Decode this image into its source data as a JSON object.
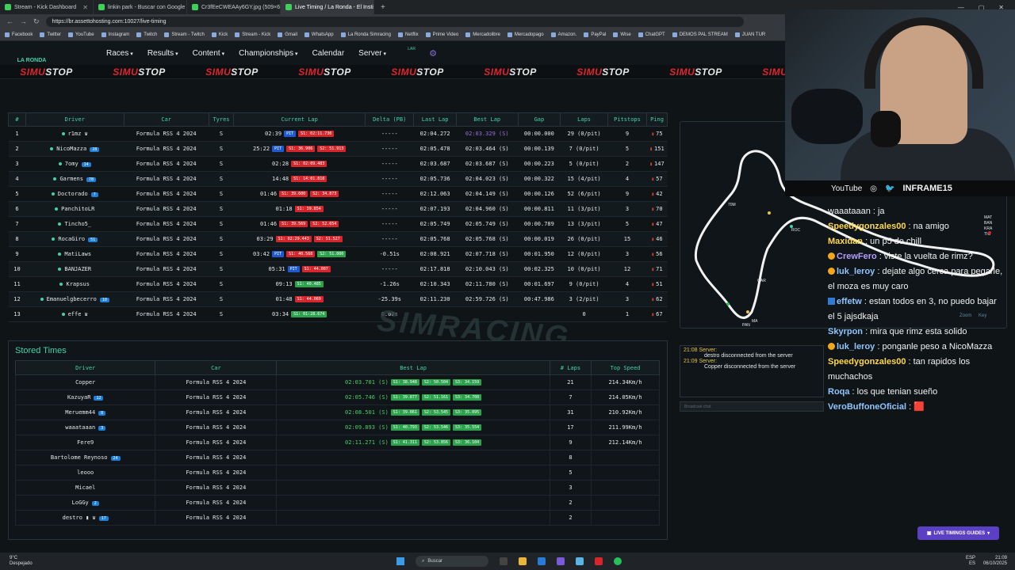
{
  "browser": {
    "tabs": [
      {
        "label": "Stream - Kick Dashboard",
        "active": false
      },
      {
        "label": "linkin park - Buscar con Google",
        "active": false
      },
      {
        "label": "Cr3fEeCWEAAy6GY.jpg (509×600)",
        "active": false
      },
      {
        "label": "Live Timing / La Ronda - El Instit",
        "active": true
      }
    ],
    "url": "https://br.assettohosting.com:10027/live-timing",
    "bookmarks": [
      "Facebook",
      "Twitter",
      "YouTube",
      "Instagram",
      "Twitch",
      "Stream - Twitch",
      "Kick",
      "Stream - Kick",
      "Gmail",
      "WhatsApp",
      "La Ronda Simracing",
      "Netflix",
      "Prime Video",
      "Mercadolibre",
      "Mercadopago",
      "Amazon.",
      "PayPal",
      "Wise",
      "ChatGPT",
      "DEMOS PAL STREAM",
      "JUAN TUR"
    ]
  },
  "site": {
    "logo_text": "LA RONDA",
    "nav": [
      {
        "label": "Races",
        "caret": true
      },
      {
        "label": "Results",
        "caret": true
      },
      {
        "label": "Content",
        "caret": true
      },
      {
        "label": "Championships",
        "caret": true
      },
      {
        "label": "Calendar",
        "caret": false
      },
      {
        "label": "Server",
        "caret": true
      }
    ],
    "small_logo": "LAR",
    "sponsor": "SIMUSTOP",
    "accent": "#3fd3a8"
  },
  "live": {
    "headers": [
      "#",
      "Driver",
      "Car",
      "Tyres",
      "Current Lap",
      "Delta (PB)",
      "Last Lap",
      "Best Lap",
      "Gap",
      "Laps",
      "Pitstops",
      "Ping"
    ],
    "rows": [
      {
        "pos": "1",
        "driver": "r1mz ♛",
        "badge": "",
        "car": "Formula RSS 4 2024",
        "tyre": "S",
        "cur": "02:39",
        "chips": [
          [
            "PIT",
            "pit"
          ],
          [
            "S1: 02:11.730",
            "red"
          ]
        ],
        "delta": "-----",
        "dcls": "delta-red",
        "last": "02:04.272",
        "best": "02:03.329 (S)",
        "bcls": "purple",
        "gap": "00:00.000",
        "laps": "29 (0/pit)",
        "pits": "9",
        "ping": "75"
      },
      {
        "pos": "2",
        "driver": "NicoMazza",
        "badge": "28",
        "car": "Formula RSS 4 2024",
        "tyre": "S",
        "cur": "25:22",
        "chips": [
          [
            "PIT",
            "pit"
          ],
          [
            "S1: 36.906",
            "red"
          ],
          [
            "S2: 51.913",
            "red"
          ]
        ],
        "delta": "-----",
        "dcls": "delta-red",
        "last": "02:05.478",
        "best": "02:03.464 (S)",
        "bcls": "",
        "gap": "00:00.139",
        "laps": "7 (0/pit)",
        "pits": "5",
        "ping": "151"
      },
      {
        "pos": "3",
        "driver": "7omy",
        "badge": "14",
        "car": "Formula RSS 4 2024",
        "tyre": "S",
        "cur": "02:28",
        "chips": [
          [
            "S1: 02:09.483",
            "red"
          ]
        ],
        "delta": "-----",
        "dcls": "delta-red",
        "last": "02:03.687",
        "best": "02:03.687 (S)",
        "bcls": "",
        "gap": "00:00.223",
        "laps": "5 (0/pit)",
        "pits": "2",
        "ping": "147"
      },
      {
        "pos": "4",
        "driver": "Garmens",
        "badge": "78",
        "car": "Formula RSS 4 2024",
        "tyre": "S",
        "cur": "14:48",
        "chips": [
          [
            "S1: 14:01.818",
            "red"
          ]
        ],
        "delta": "-----",
        "dcls": "delta-red",
        "last": "02:05.736",
        "best": "02:04.023 (S)",
        "bcls": "",
        "gap": "00:00.322",
        "laps": "15 (4/pit)",
        "pits": "4",
        "ping": "57"
      },
      {
        "pos": "5",
        "driver": "Doctorado",
        "badge": "7",
        "car": "Formula RSS 4 2024",
        "tyre": "S",
        "cur": "01:46",
        "chips": [
          [
            "S1: 39.600",
            "red"
          ],
          [
            "S2: 34.873",
            "red"
          ]
        ],
        "delta": "-----",
        "dcls": "delta-red",
        "last": "02:12.063",
        "best": "02:04.149 (S)",
        "bcls": "",
        "gap": "00:00.126",
        "laps": "52 (6/pit)",
        "pits": "9",
        "ping": "42"
      },
      {
        "pos": "6",
        "driver": "PanchitoLR",
        "badge": "",
        "car": "Formula RSS 4 2024",
        "tyre": "S",
        "cur": "01:18",
        "chips": [
          [
            "S1: 39.854",
            "red"
          ]
        ],
        "delta": "-----",
        "dcls": "delta-red",
        "last": "02:07.193",
        "best": "02:04.960 (S)",
        "bcls": "",
        "gap": "00:00.811",
        "laps": "11 (3/pit)",
        "pits": "3",
        "ping": "70"
      },
      {
        "pos": "7",
        "driver": "Tincho5_",
        "badge": "",
        "car": "Formula RSS 4 2024",
        "tyre": "S",
        "cur": "01:46",
        "chips": [
          [
            "S1: 39.569",
            "red"
          ],
          [
            "S2: 52.654",
            "red"
          ]
        ],
        "delta": "-----",
        "dcls": "delta-red",
        "last": "02:05.749",
        "best": "02:05.749 (S)",
        "bcls": "",
        "gap": "00:00.789",
        "laps": "13 (3/pit)",
        "pits": "5",
        "ping": "47"
      },
      {
        "pos": "8",
        "driver": "RocaGiro",
        "badge": "51",
        "car": "Formula RSS 4 2024",
        "tyre": "S",
        "cur": "03:29",
        "chips": [
          [
            "S1: 02:29.443",
            "red"
          ],
          [
            "S2: 51.527",
            "red"
          ]
        ],
        "delta": "-----",
        "dcls": "delta-red",
        "last": "02:05.768",
        "best": "02:05.768 (S)",
        "bcls": "",
        "gap": "00:00.019",
        "laps": "26 (0/pit)",
        "pits": "15",
        "ping": "46"
      },
      {
        "pos": "9",
        "driver": "MatiLaws",
        "badge": "",
        "car": "Formula RSS 4 2024",
        "tyre": "S",
        "cur": "03:42",
        "chips": [
          [
            "PIT",
            "pit"
          ],
          [
            "S1: 40.568",
            "red"
          ],
          [
            "S2: 51.000",
            "green"
          ]
        ],
        "delta": "-0.51s",
        "dcls": "delta-green",
        "last": "02:08.921",
        "best": "02:07.718 (S)",
        "bcls": "",
        "gap": "00:01.950",
        "laps": "12 (0/pit)",
        "pits": "3",
        "ping": "56"
      },
      {
        "pos": "10",
        "driver": "BANJAZER",
        "badge": "",
        "car": "Formula RSS 4 2024",
        "tyre": "S",
        "cur": "05:31",
        "chips": [
          [
            "PIT",
            "pit"
          ],
          [
            "S1: 44.007",
            "red"
          ]
        ],
        "delta": "-----",
        "dcls": "delta-red",
        "last": "02:17.818",
        "best": "02:10.043 (S)",
        "bcls": "",
        "gap": "00:02.325",
        "laps": "10 (0/pit)",
        "pits": "12",
        "ping": "71"
      },
      {
        "pos": "11",
        "driver": "Krapsus",
        "badge": "",
        "car": "Formula RSS 4 2024",
        "tyre": "S",
        "cur": "09:13",
        "chips": [
          [
            "S1: 40.485",
            "green"
          ]
        ],
        "delta": "-1.26s",
        "dcls": "delta-green",
        "last": "02:10.343",
        "best": "02:11.780 (S)",
        "bcls": "",
        "gap": "00:01.697",
        "laps": "9 (0/pit)",
        "pits": "4",
        "ping": "51"
      },
      {
        "pos": "12",
        "driver": "Emanuelgbecerro",
        "badge": "10",
        "car": "Formula RSS 4 2024",
        "tyre": "S",
        "cur": "01:48",
        "chips": [
          [
            "S1: 44.069",
            "red"
          ]
        ],
        "delta": "-25.39s",
        "dcls": "delta-green",
        "last": "02:11.230",
        "best": "02:59.726 (S)",
        "bcls": "",
        "gap": "00:47.986",
        "laps": "3 (2/pit)",
        "pits": "3",
        "ping": "62"
      },
      {
        "pos": "13",
        "driver": "effe ♛",
        "badge": "",
        "car": "Formula RSS 4 2024",
        "tyre": "S",
        "cur": "03:34",
        "chips": [
          [
            "S1: 01:28.674",
            "green"
          ]
        ],
        "delta": "0.00s",
        "dcls": "delta-yellow",
        "last": "",
        "best": "",
        "bcls": "",
        "gap": "",
        "laps": "0",
        "pits": "1",
        "ping": "67"
      }
    ]
  },
  "stored": {
    "title": "Stored Times",
    "headers": [
      "Driver",
      "Car",
      "Best Lap",
      "# Laps",
      "Top Speed"
    ],
    "rows": [
      {
        "driver": "Copper",
        "badge": "",
        "car": "Formula RSS 4 2024",
        "best": "02:03.701 (S)",
        "splits": [
          "S1: 38.948",
          "S2: 50.504",
          "S3: 34.159"
        ],
        "laps": "21",
        "speed": "214.34Km/h"
      },
      {
        "driver": "KazuyaR",
        "badge": "12",
        "car": "Formula RSS 4 2024",
        "best": "02:05.746 (S)",
        "splits": [
          "S1: 39.877",
          "S2: 51.161",
          "S3: 34.708"
        ],
        "laps": "7",
        "speed": "214.05Km/h"
      },
      {
        "driver": "Meruemm44",
        "badge": "8",
        "car": "Formula RSS 4 2024",
        "best": "02:08.501 (S)",
        "splits": [
          "S1: 39.861",
          "S2: 53.545",
          "S3: 35.095"
        ],
        "laps": "31",
        "speed": "210.92Km/h"
      },
      {
        "driver": "waaataaan",
        "badge": "3",
        "car": "Formula RSS 4 2024",
        "best": "02:09.893 (S)",
        "splits": [
          "S1: 40.793",
          "S2: 53.546",
          "S3: 35.554"
        ],
        "laps": "17",
        "speed": "211.99Km/h"
      },
      {
        "driver": "Fere9",
        "badge": "",
        "car": "Formula RSS 4 2024",
        "best": "02:11.271 (S)",
        "splits": [
          "S1: 41.311",
          "S2: 53.856",
          "S3: 36.104"
        ],
        "laps": "9",
        "speed": "212.14Km/h"
      },
      {
        "driver": "Bartolome Reynoso",
        "badge": "24",
        "car": "Formula RSS 4 2024",
        "best": "",
        "splits": [],
        "laps": "8",
        "speed": ""
      },
      {
        "driver": "leooo",
        "badge": "",
        "car": "Formula RSS 4 2024",
        "best": "",
        "splits": [],
        "laps": "5",
        "speed": ""
      },
      {
        "driver": "Micael",
        "badge": "",
        "car": "Formula RSS 4 2024",
        "best": "",
        "splits": [],
        "laps": "3",
        "speed": ""
      },
      {
        "driver": "LoGGy",
        "badge": "2",
        "car": "Formula RSS 4 2024",
        "best": "",
        "splits": [],
        "laps": "2",
        "speed": ""
      },
      {
        "driver": "destro ▮ ♛",
        "badge": "17",
        "car": "Formula RSS 4 2024",
        "best": "",
        "splits": [],
        "laps": "2",
        "speed": ""
      }
    ]
  },
  "map": {
    "labels": [
      "70M",
      "ROC",
      "GAR",
      "MA",
      "PAN",
      "MAT",
      "BAN",
      "KRA",
      "TIC"
    ],
    "zoom": "Zoom",
    "key": "Key"
  },
  "server_log": [
    {
      "time": "21:08 Server:",
      "msg": "destro disconnected from the server"
    },
    {
      "time": "21:09 Server:",
      "msg": "Copper disconnected from the server"
    }
  ],
  "broadcast_placeholder": "Broadcast chat",
  "stream": {
    "socials": [
      "YouTube",
      "◎",
      "🐦"
    ],
    "handle": "INFRAME15",
    "chat": [
      {
        "user": "",
        "cls": "",
        "text": "waaataaan : ja",
        "badge": ""
      },
      {
        "user": "Speedygonzales00",
        "cls": "u1",
        "text": " : na amigo",
        "badge": ""
      },
      {
        "user": "Maxidan",
        "cls": "u1",
        "text": " : un p5 de chill",
        "badge": ""
      },
      {
        "user": "CrewFero",
        "cls": "u3",
        "text": " : viste la vuelta de rimz?",
        "badge": "gold"
      },
      {
        "user": "luk_leroy",
        "cls": "u2",
        "text": " : dejate algo cerca para pegarle, el moza es muy caro",
        "badge": "gold"
      },
      {
        "user": "effetw",
        "cls": "u2",
        "text": " : estan todos en 3, no puedo bajar el 5 jajsdkaja",
        "badge": "blue"
      },
      {
        "user": "Skyrpon",
        "cls": "u2",
        "text": " : mira que rimz esta solido",
        "badge": ""
      },
      {
        "user": "luk_leroy",
        "cls": "u2",
        "text": " : ponganle peso a NicoMazza",
        "badge": "gold"
      },
      {
        "user": "Speedygonzales00",
        "cls": "u1",
        "text": " : tan rapidos los muchachos",
        "badge": ""
      },
      {
        "user": "Roqa",
        "cls": "u2",
        "text": " : los que tenian sueño",
        "badge": ""
      },
      {
        "user": "VeroBuffoneOficial",
        "cls": "u2",
        "text": " : 🟥",
        "badge": ""
      }
    ]
  },
  "guides_button": "LIVE TIMINGS GUIDES",
  "taskbar": {
    "temp": "9°C",
    "weather": "Despejado",
    "search": "Buscar",
    "lang1": "ESP",
    "lang2": "ES",
    "time": "21:09",
    "date": "06/10/2025"
  }
}
